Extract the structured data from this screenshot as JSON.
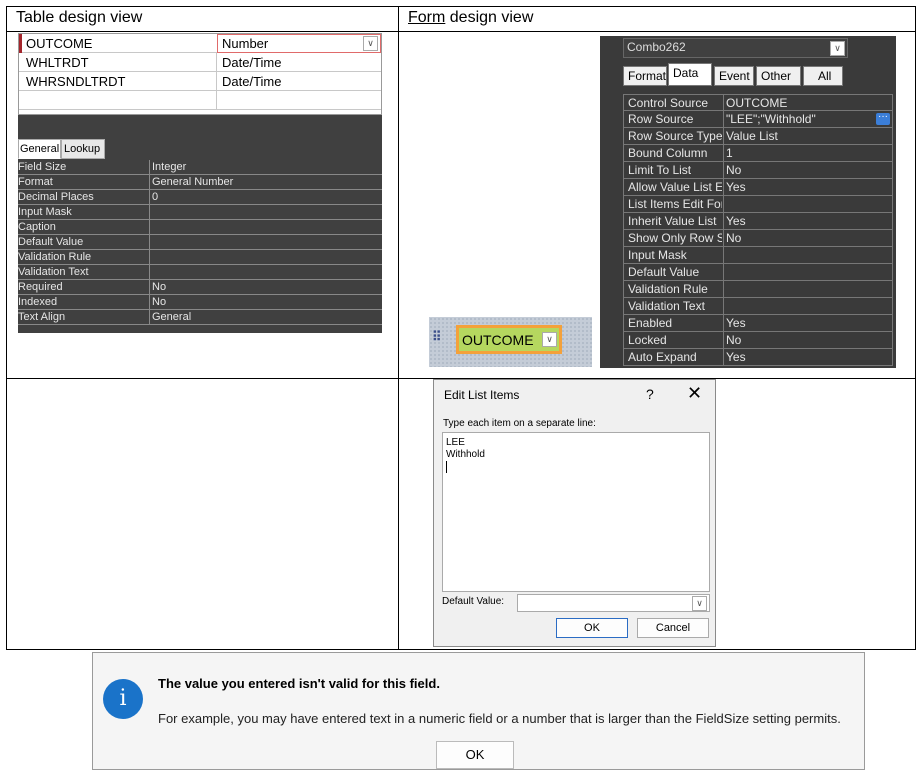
{
  "headers": {
    "table_view": "Table design view",
    "form_word": "Form",
    "form_rest": " design view"
  },
  "table_fields": [
    {
      "name": "OUTCOME",
      "type": "Number"
    },
    {
      "name": "WHLTRDT",
      "type": "Date/Time"
    },
    {
      "name": "WHRSNDLTRDT",
      "type": "Date/Time"
    }
  ],
  "field_tabs": [
    "General",
    "Lookup"
  ],
  "field_props": [
    {
      "name": "Field Size",
      "value": "Integer"
    },
    {
      "name": "Format",
      "value": "General Number"
    },
    {
      "name": "Decimal Places",
      "value": "0"
    },
    {
      "name": "Input Mask",
      "value": ""
    },
    {
      "name": "Caption",
      "value": ""
    },
    {
      "name": "Default Value",
      "value": ""
    },
    {
      "name": "Validation Rule",
      "value": ""
    },
    {
      "name": "Validation Text",
      "value": ""
    },
    {
      "name": "Required",
      "value": "No"
    },
    {
      "name": "Indexed",
      "value": "No"
    },
    {
      "name": "Text Align",
      "value": "General"
    }
  ],
  "form": {
    "combo_name": "Combo262",
    "tabs": [
      "Format",
      "Data",
      "Event",
      "Other",
      "All"
    ],
    "props": [
      {
        "name": "Control Source",
        "value": "OUTCOME"
      },
      {
        "name": "Row Source",
        "value": "\"LEE\";\"Withhold\""
      },
      {
        "name": "Row Source Type",
        "value": "Value List"
      },
      {
        "name": "Bound Column",
        "value": "1"
      },
      {
        "name": "Limit To List",
        "value": "No"
      },
      {
        "name": "Allow Value List Edits",
        "value": "Yes"
      },
      {
        "name": "List Items Edit Form",
        "value": ""
      },
      {
        "name": "Inherit Value List",
        "value": "Yes"
      },
      {
        "name": "Show Only Row Source Values",
        "value": "No"
      },
      {
        "name": "Input Mask",
        "value": ""
      },
      {
        "name": "Default Value",
        "value": ""
      },
      {
        "name": "Validation Rule",
        "value": ""
      },
      {
        "name": "Validation Text",
        "value": ""
      },
      {
        "name": "Enabled",
        "value": "Yes"
      },
      {
        "name": "Locked",
        "value": "No"
      },
      {
        "name": "Auto Expand",
        "value": "Yes"
      }
    ],
    "control_label": "OUTCOME"
  },
  "edit_list": {
    "title": "Edit List Items",
    "help": "?",
    "close": "✕",
    "instruction": "Type each item on a separate line:",
    "items": [
      "LEE",
      "Withhold"
    ],
    "default_label": "Default Value:",
    "ok": "OK",
    "cancel": "Cancel"
  },
  "error": {
    "title": "The value you entered isn't valid for this field.",
    "message": "For example, you may have entered text in a numeric field or a number that is larger than the FieldSize setting permits.",
    "ok": "OK"
  },
  "colors": {
    "dark_panel": "#404040",
    "control_fill": "#b5d75f",
    "control_border": "#f4a13a",
    "info_blue": "#1a73c9"
  }
}
